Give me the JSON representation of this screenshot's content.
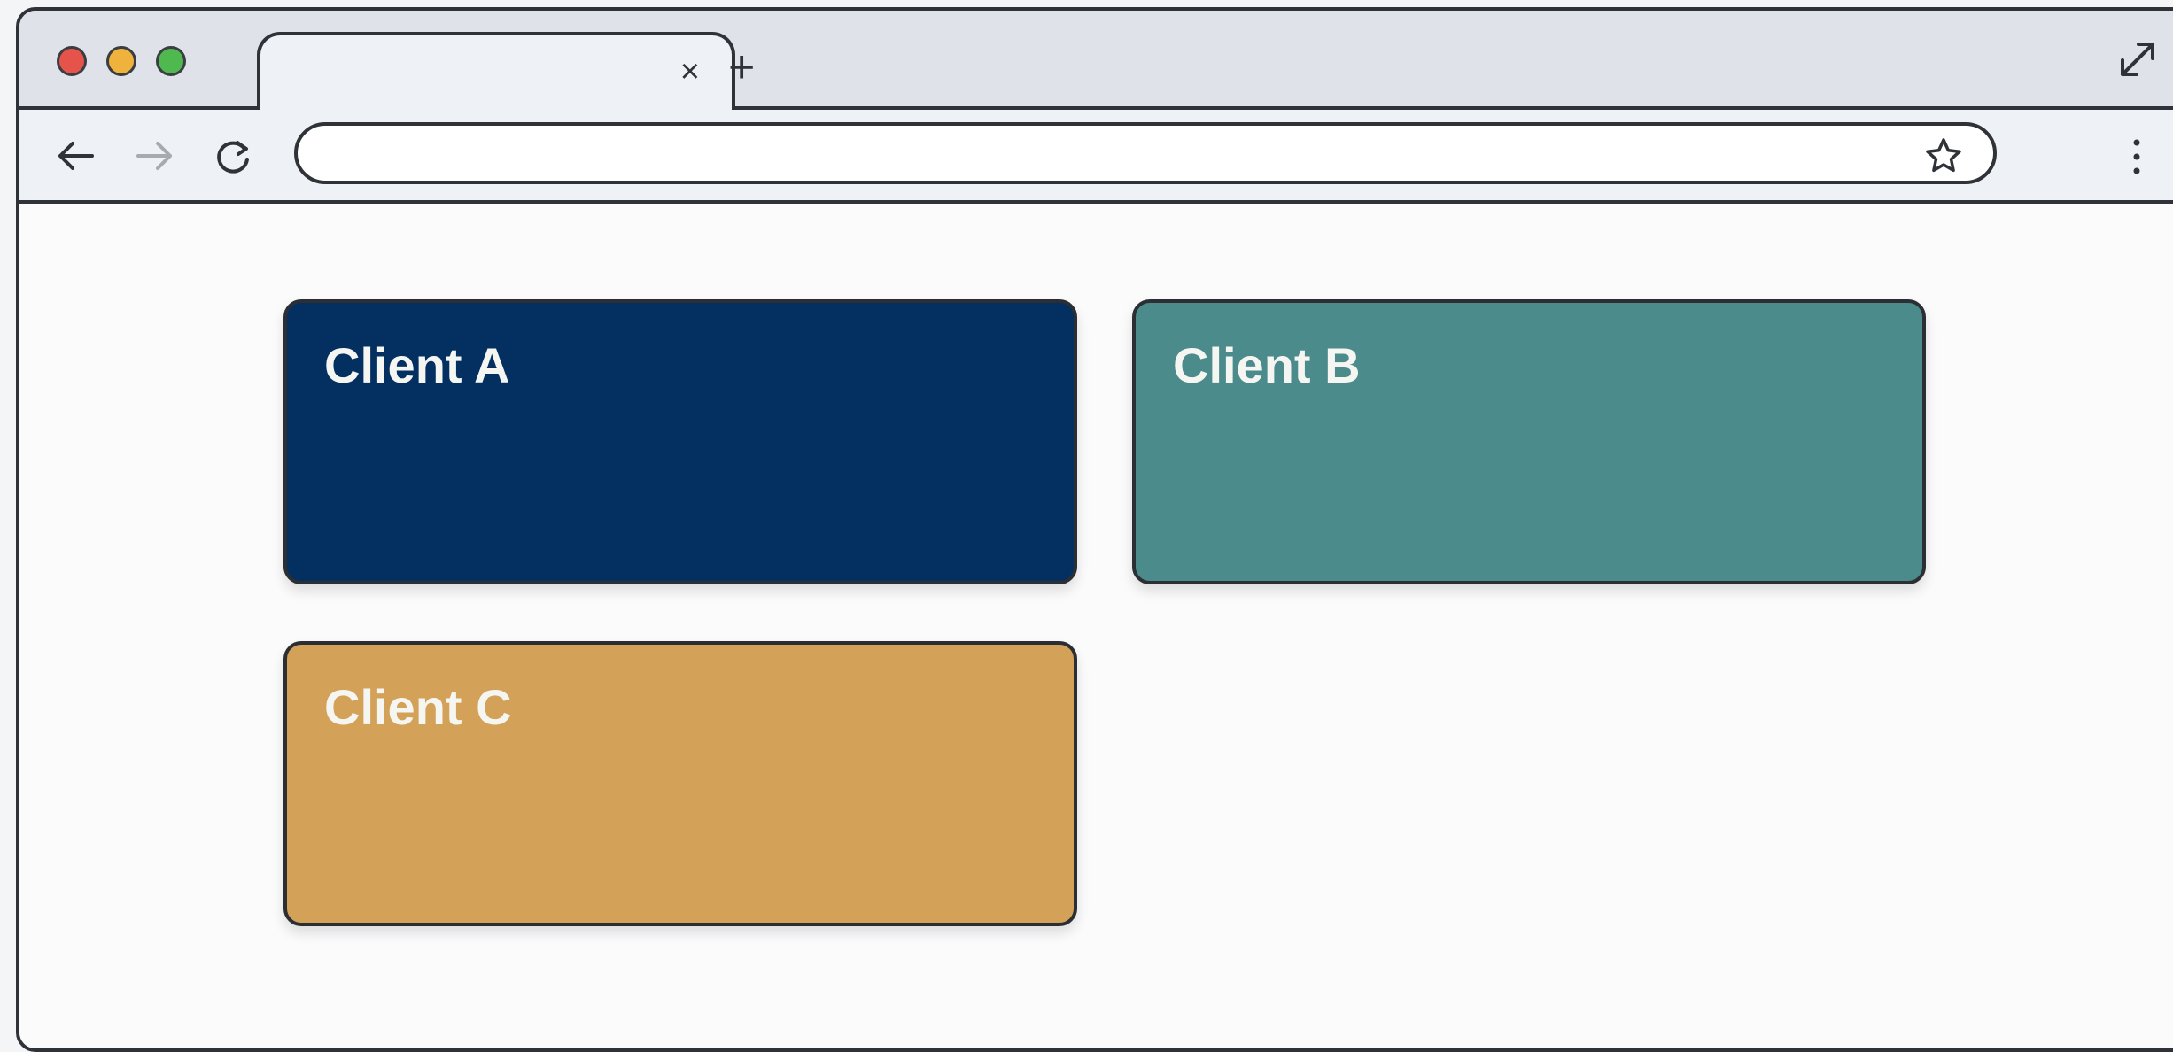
{
  "browser": {
    "tab": {
      "title": "",
      "close_symbol": "×"
    },
    "new_tab_symbol": "+",
    "address_bar": {
      "value": ""
    },
    "icons": [
      "close-icon",
      "plus-icon",
      "expand-icon",
      "back-arrow-icon",
      "forward-arrow-icon",
      "reload-icon",
      "star-icon",
      "more-menu-icon"
    ]
  },
  "cards": [
    {
      "title": "Client A",
      "color": "#033060"
    },
    {
      "title": "Client B",
      "color": "#4c8b8b"
    },
    {
      "title": "Client C",
      "color": "#d3a258"
    }
  ]
}
